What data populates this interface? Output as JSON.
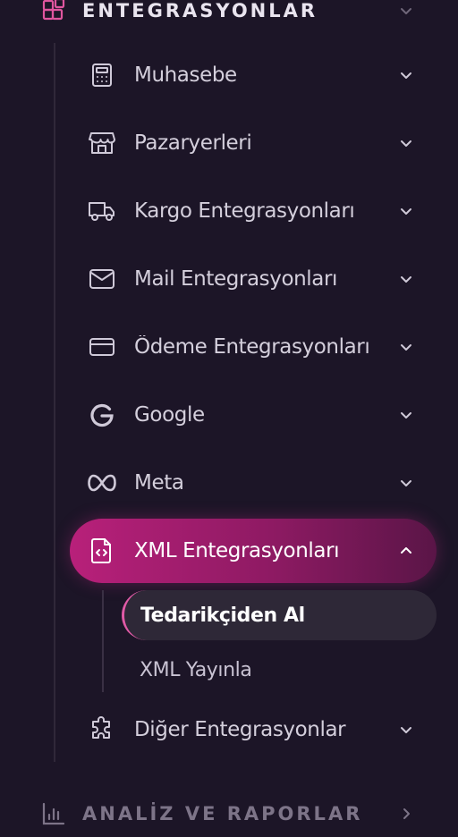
{
  "sections": {
    "integrations": {
      "label": "ENTEGRASYONLAR",
      "icon": "blocks-icon",
      "accent": "#e0569f"
    },
    "analytics": {
      "label": "ANALİZ VE RAPORLAR",
      "icon": "bar-chart-icon"
    }
  },
  "menu": {
    "items": [
      {
        "label": "Muhasebe",
        "icon": "calculator-icon"
      },
      {
        "label": "Pazaryerleri",
        "icon": "store-icon"
      },
      {
        "label": "Kargo Entegrasyonları",
        "icon": "truck-icon"
      },
      {
        "label": "Mail Entegrasyonları",
        "icon": "mail-icon"
      },
      {
        "label": "Ödeme Entegrasyonları",
        "icon": "credit-card-icon"
      },
      {
        "label": "Google",
        "icon": "google-icon"
      },
      {
        "label": "Meta",
        "icon": "meta-icon"
      },
      {
        "label": "XML Entegrasyonları",
        "icon": "file-code-icon",
        "active": true
      },
      {
        "label": "Diğer Entegrasyonlar",
        "icon": "puzzle-icon"
      }
    ],
    "xml_submenu": [
      {
        "label": "Tedarikçiden Al",
        "selected": true
      },
      {
        "label": "XML Yayınla"
      }
    ]
  },
  "colors": {
    "background": "#1c1527",
    "active_gradient_start": "#b8207a",
    "active_gradient_end": "#5a1547",
    "selected_sub_bg": "#2e2837",
    "selected_sub_border": "#e05aa6"
  }
}
